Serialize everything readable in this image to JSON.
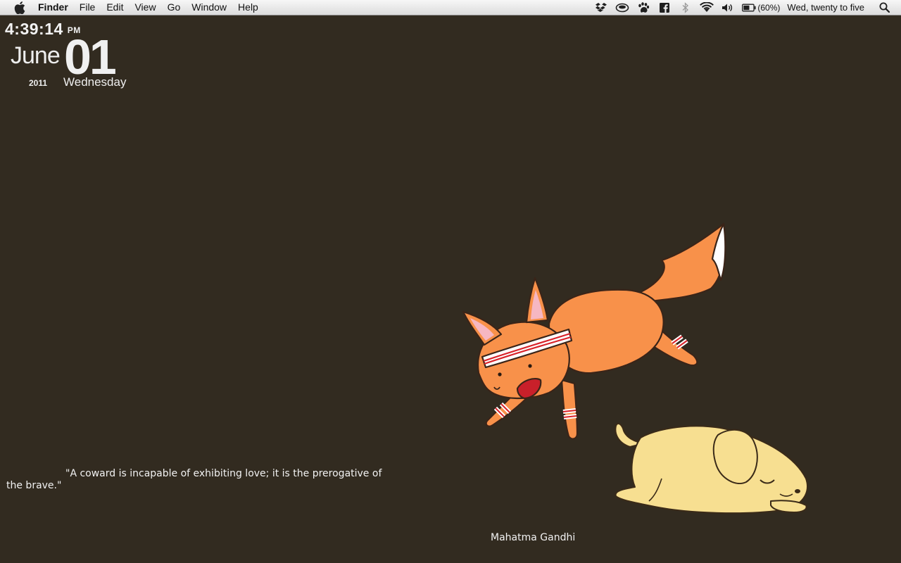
{
  "menubar": {
    "app_name": "Finder",
    "menus": [
      "File",
      "Edit",
      "View",
      "Go",
      "Window",
      "Help"
    ],
    "status_icons": [
      "dropbox-icon",
      "cloud-app-icon",
      "paw-icon",
      "facebook-icon",
      "bluetooth-icon",
      "wifi-icon",
      "volume-icon",
      "battery-icon"
    ],
    "battery_percent": "(60%)",
    "clock": "Wed, twenty to five"
  },
  "widget": {
    "time": "4:39:14",
    "ampm": "PM",
    "month": "June",
    "day": "01",
    "year": "2011",
    "weekday": "Wednesday"
  },
  "quote": {
    "text": "\"A coward is incapable of exhibiting love; it is the prerogative of the brave.\"",
    "author": "Mahatma Gandhi"
  },
  "colors": {
    "desktop_bg": "#322b20",
    "fox": "#f8914a",
    "dog": "#f7df91"
  }
}
